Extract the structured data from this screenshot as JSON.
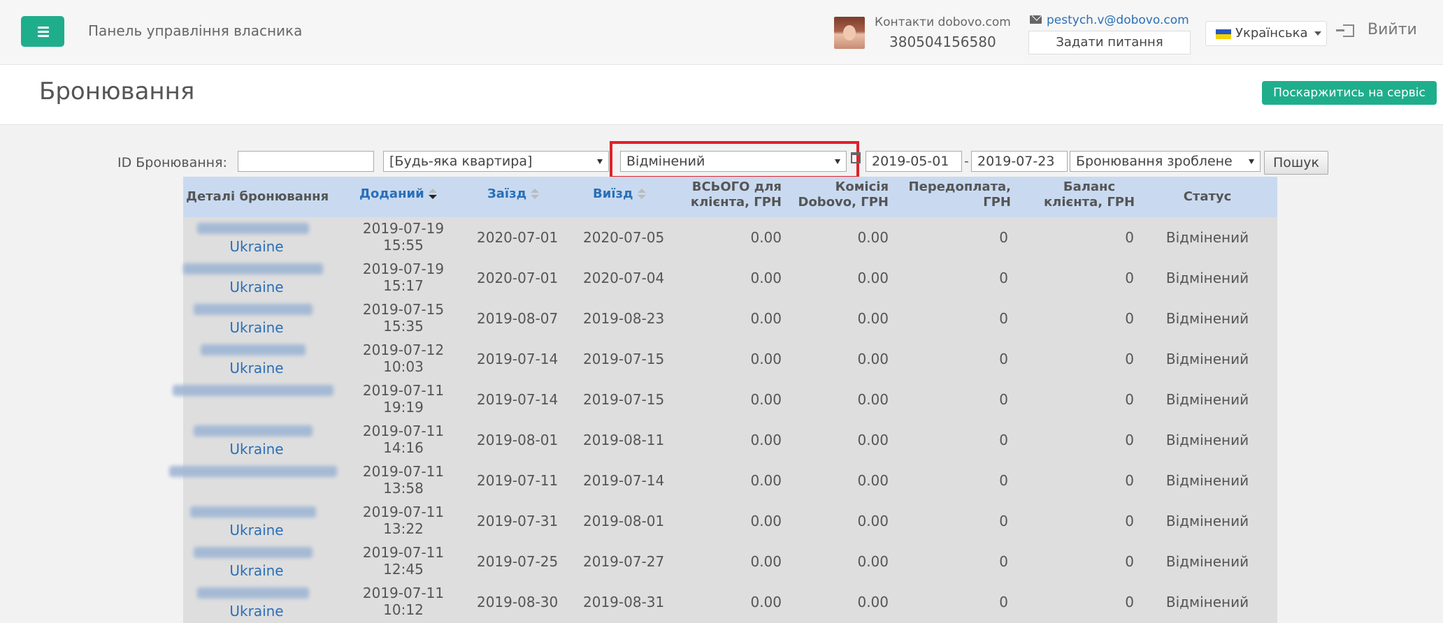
{
  "topbar": {
    "panel_title": "Панель управління власника",
    "contacts_label": "Контакти dobovo.com",
    "contacts_phone": "380504156580",
    "email": "pestych.v@dobovo.com",
    "ask_button": "Задати питання",
    "language": "Українська",
    "logout": "Вийти"
  },
  "header": {
    "title": "Бронювання",
    "complain_button": "Поскаржитись на сервіс"
  },
  "filters": {
    "id_label": "ID Бронювання:",
    "id_value": "",
    "apartment": "[Будь-яка квартира]",
    "status": "Відмінений",
    "date_from": "2019-05-01",
    "date_to": "2019-07-23",
    "date_type": "Бронювання зроблене",
    "search_button": "Пошук"
  },
  "table": {
    "columns": [
      {
        "label": "Деталі бронювання"
      },
      {
        "label": "Доданий"
      },
      {
        "label": "Заїзд"
      },
      {
        "label": "Виїзд"
      },
      {
        "label1": "ВСЬОГО для",
        "label2": "клієнта, ГРН"
      },
      {
        "label1": "Комісія",
        "label2": "Dobovo, ГРН"
      },
      {
        "label1": "Передоплата,",
        "label2": "ГРН"
      },
      {
        "label1": "Баланс",
        "label2": "клієнта, ГРН"
      },
      {
        "label": "Статус"
      }
    ],
    "rows": [
      {
        "country": "Ukraine",
        "added_date": "2019-07-19",
        "added_time": "15:55",
        "checkin": "2020-07-01",
        "checkout": "2020-07-05",
        "total": "0.00",
        "commission": "0.00",
        "prepay": "0",
        "balance": "0",
        "status": "Відмінений"
      },
      {
        "country": "Ukraine",
        "added_date": "2019-07-19",
        "added_time": "15:17",
        "checkin": "2020-07-01",
        "checkout": "2020-07-04",
        "total": "0.00",
        "commission": "0.00",
        "prepay": "0",
        "balance": "0",
        "status": "Відмінений"
      },
      {
        "country": "Ukraine",
        "added_date": "2019-07-15",
        "added_time": "15:35",
        "checkin": "2019-08-07",
        "checkout": "2019-08-23",
        "total": "0.00",
        "commission": "0.00",
        "prepay": "0",
        "balance": "0",
        "status": "Відмінений"
      },
      {
        "country": "Ukraine",
        "added_date": "2019-07-12",
        "added_time": "10:03",
        "checkin": "2019-07-14",
        "checkout": "2019-07-15",
        "total": "0.00",
        "commission": "0.00",
        "prepay": "0",
        "balance": "0",
        "status": "Відмінений"
      },
      {
        "country": "",
        "added_date": "2019-07-11",
        "added_time": "19:19",
        "checkin": "2019-07-14",
        "checkout": "2019-07-15",
        "total": "0.00",
        "commission": "0.00",
        "prepay": "0",
        "balance": "0",
        "status": "Відмінений"
      },
      {
        "country": "Ukraine",
        "added_date": "2019-07-11",
        "added_time": "14:16",
        "checkin": "2019-08-01",
        "checkout": "2019-08-11",
        "total": "0.00",
        "commission": "0.00",
        "prepay": "0",
        "balance": "0",
        "status": "Відмінений"
      },
      {
        "country": "",
        "added_date": "2019-07-11",
        "added_time": "13:58",
        "checkin": "2019-07-11",
        "checkout": "2019-07-14",
        "total": "0.00",
        "commission": "0.00",
        "prepay": "0",
        "balance": "0",
        "status": "Відмінений"
      },
      {
        "country": "Ukraine",
        "added_date": "2019-07-11",
        "added_time": "13:22",
        "checkin": "2019-07-31",
        "checkout": "2019-08-01",
        "total": "0.00",
        "commission": "0.00",
        "prepay": "0",
        "balance": "0",
        "status": "Відмінений"
      },
      {
        "country": "Ukraine",
        "added_date": "2019-07-11",
        "added_time": "12:45",
        "checkin": "2019-07-25",
        "checkout": "2019-07-27",
        "total": "0.00",
        "commission": "0.00",
        "prepay": "0",
        "balance": "0",
        "status": "Відмінений"
      },
      {
        "country": "Ukraine",
        "added_date": "2019-07-11",
        "added_time": "10:12",
        "checkin": "2019-08-30",
        "checkout": "2019-08-31",
        "total": "0.00",
        "commission": "0.00",
        "prepay": "0",
        "balance": "0",
        "status": "Відмінений"
      }
    ]
  },
  "colors": {
    "accent": "#1fae8c",
    "link": "#2a6fb8",
    "table_header": "#c9daf0",
    "table_body": "#dedede",
    "highlight": "#e0202a"
  },
  "icons": [
    "menu-icon",
    "email-icon",
    "ukraine-flag-icon",
    "caret-down-icon",
    "logout-icon",
    "calendar-icon",
    "sort-icon"
  ]
}
